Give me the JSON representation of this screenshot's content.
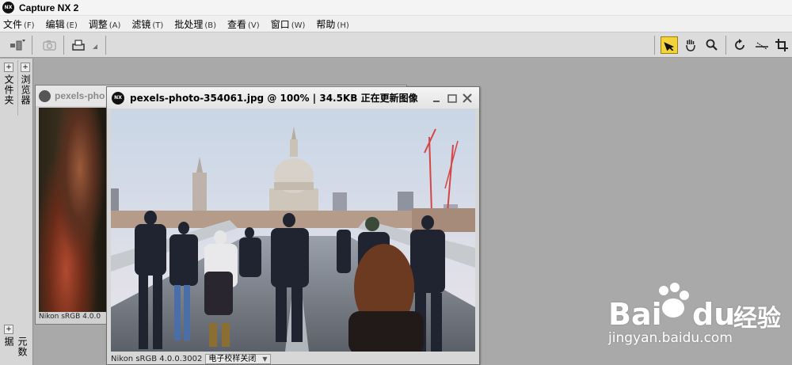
{
  "app": {
    "title": "Capture NX 2",
    "logo_text": "NX"
  },
  "menu": [
    {
      "label": "文件",
      "key": "(F)"
    },
    {
      "label": "编辑",
      "key": "(E)"
    },
    {
      "label": "调整",
      "key": "(A)"
    },
    {
      "label": "滤镜",
      "key": "(T)"
    },
    {
      "label": "批处理",
      "key": "(B)"
    },
    {
      "label": "查看",
      "key": "(V)"
    },
    {
      "label": "窗口",
      "key": "(W)"
    },
    {
      "label": "帮助",
      "key": "(H)"
    }
  ],
  "toolbar": {
    "left": [
      "browser-toggle-icon",
      "camera-icon",
      "print-icon"
    ],
    "right": [
      "direct-select-icon",
      "hand-icon",
      "zoom-icon",
      "rotate-icon",
      "straighten-icon",
      "crop-icon"
    ],
    "active_color": "#f3d33a"
  },
  "left_dock": {
    "folders_label": "文件夹",
    "browser_label": "浏览器",
    "metadata_label": "元数据",
    "expand_glyph": "+"
  },
  "windows": {
    "back": {
      "title": "pexels-pho",
      "status": "Nikon sRGB 4.0.0"
    },
    "front": {
      "filename": "pexels-photo-354061.jpg",
      "zoom": "@ 100%",
      "separator": "|",
      "size": "34.5KB",
      "state": "正在更新图像",
      "status_profile": "Nikon sRGB 4.0.0.3002",
      "proof_label": "电子校样关闭",
      "proof_arrow": "▼"
    }
  },
  "watermark": {
    "brand_a": "Bai",
    "brand_b": "du",
    "brand_cn": "经验",
    "url": "jingyan.baidu.com"
  }
}
